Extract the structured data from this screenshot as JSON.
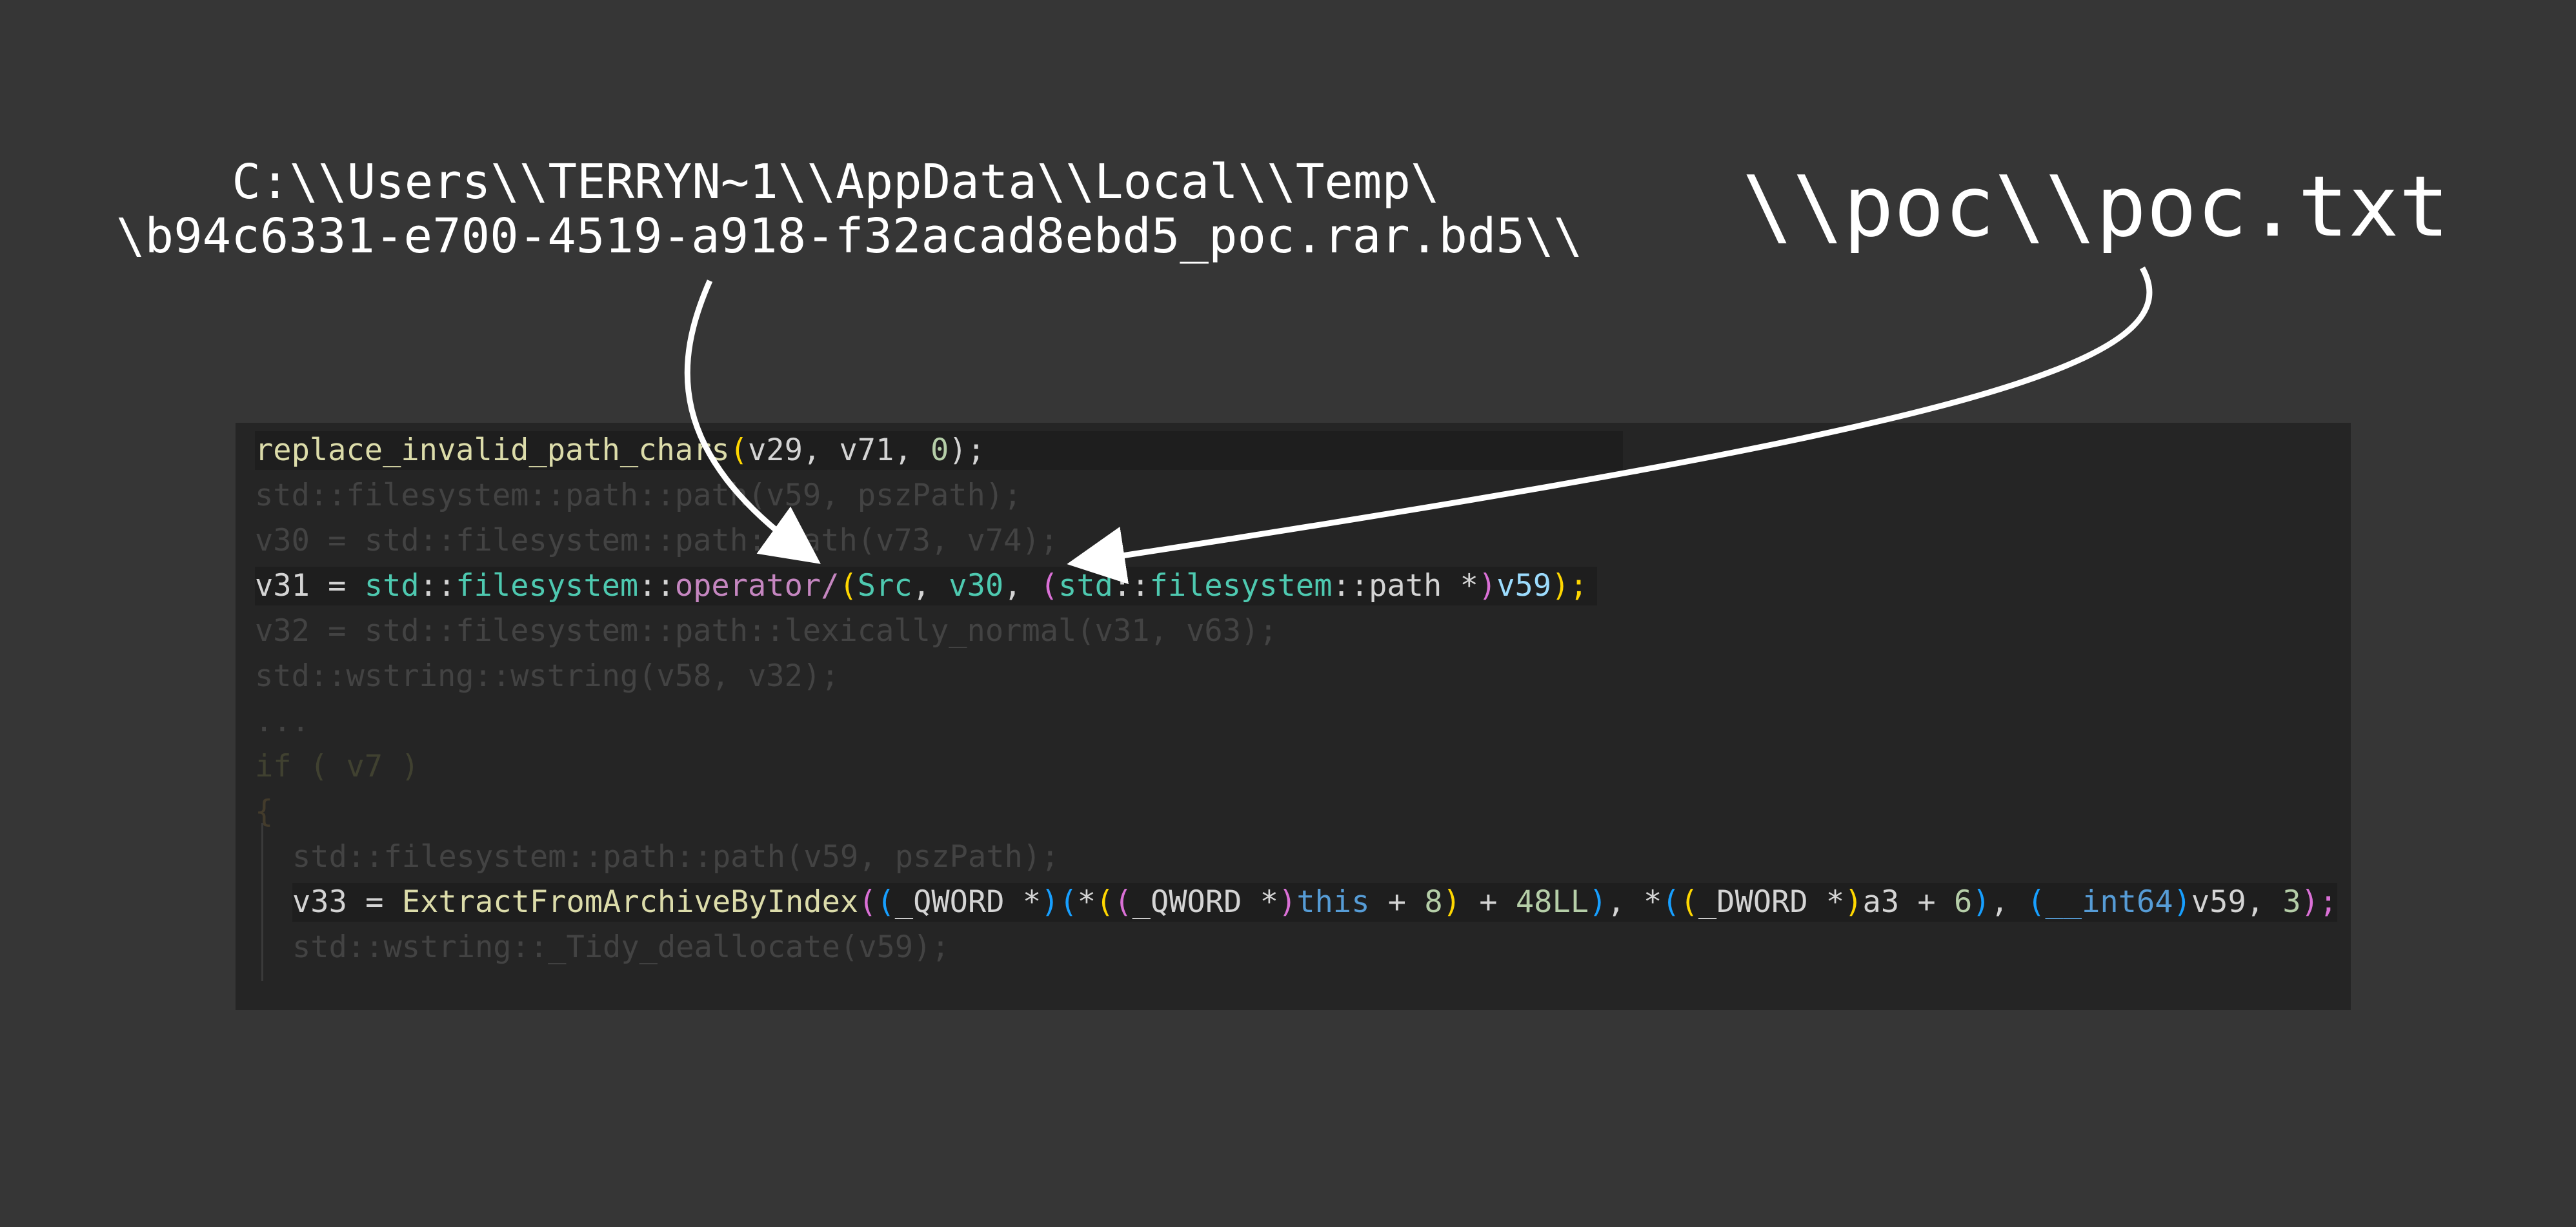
{
  "annotations": {
    "path_prefix_line1": "C:\\\\Users\\\\TERRYN~1\\\\AppData\\\\Local\\\\Temp\\",
    "path_prefix_line2": "\\b94c6331-e700-4519-a918-f32acad8ebd5_poc.rar.bd5\\\\",
    "path_suffix": "\\\\poc\\\\poc.txt"
  },
  "code": {
    "l1": {
      "fn": "replace_invalid_path_chars",
      "p1": "(",
      "args": "v29, v71, ",
      "num": "0",
      "p2": ");"
    },
    "l2": "std::filesystem::path::path(v59, pszPath);",
    "l3": "v30 = std::filesystem::path::path(v73, v74);",
    "l4": {
      "lhs": "v31 = ",
      "ns1": "std",
      "sep1": "::",
      "ns2": "filesystem",
      "sep2": "::",
      "op": "operator/",
      "p1": "(",
      "a1": "Src",
      "c1": ", ",
      "a2": "v30",
      "c2": ", ",
      "p2": "(",
      "ns3": "std",
      "sep3": "::",
      "ns4": "filesystem",
      "sep4": "::",
      "ty": "path *",
      "p3": ")",
      "a3": "v59",
      "p4": ");"
    },
    "l5": "v32 = std::filesystem::path::lexically_normal(v31, v63);",
    "l6": "std::wstring::wstring(v58, v32);",
    "l7": "...",
    "l8": "if ( v7 )",
    "l9": "{",
    "l10": "std::filesystem::path::path(v59, pszPath);",
    "l11": {
      "lhs": "v33 = ",
      "fn": "ExtractFromArchiveByIndex",
      "a": "(",
      "b": "(",
      "c": "_QWORD *",
      "d": ")",
      "e": "(",
      "f": "*",
      "g": "(",
      "h": "(",
      "i": "_QWORD *",
      "j": ")",
      "k": "this",
      "l": " + ",
      "m": "8",
      "n": ")",
      "o": " + ",
      "q": "48LL",
      "r": ")",
      "s": ", *",
      "t": "(",
      "u": "(",
      "w": "_DWORD *",
      "x": ")",
      "y": "a3 + ",
      "z": "6",
      "aa": ")",
      "ab": ", ",
      "ac": "(",
      "ad": "__int64",
      "ae": ")",
      "af": "v59, ",
      "ag": "3",
      "ah": ");"
    },
    "l12": "std::wstring::_Tidy_deallocate(v59);"
  }
}
